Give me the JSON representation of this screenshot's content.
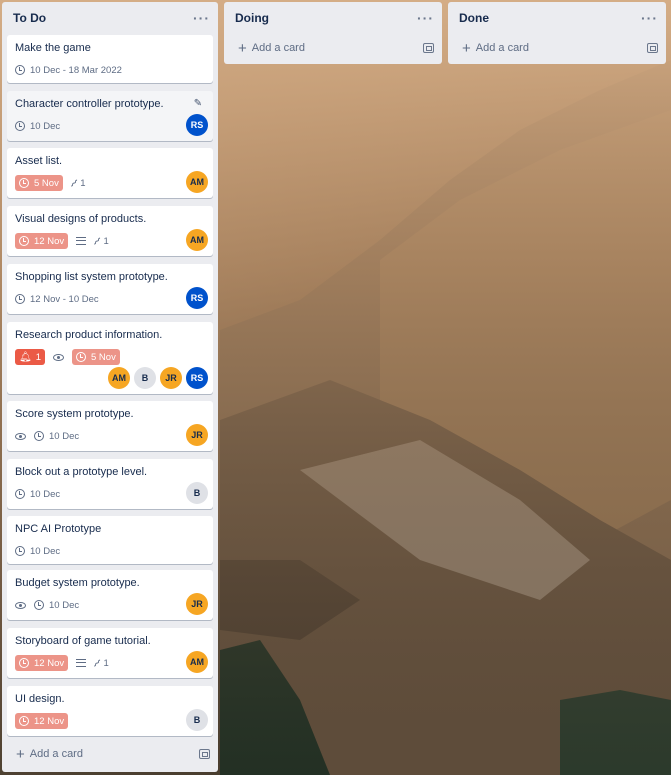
{
  "lists": {
    "todo": {
      "title": "To Do",
      "menu": "···",
      "add_card": "Add a card",
      "cards": [
        {
          "title": "Make the game",
          "due": "10 Dec - 18 Mar 2022"
        },
        {
          "title": "Character controller prototype.",
          "due": "10 Dec",
          "members": [
            "RS"
          ]
        },
        {
          "title": "Asset list.",
          "due": "5 Nov",
          "attachments": "1",
          "members": [
            "AM"
          ]
        },
        {
          "title": "Visual designs of products.",
          "due": "12 Nov",
          "attachments": "1",
          "members": [
            "AM"
          ]
        },
        {
          "title": "Shopping list system prototype.",
          "due": "12 Nov - 10 Dec",
          "members": [
            "RS"
          ]
        },
        {
          "title": "Research product information.",
          "notifications": "1",
          "due": "5 Nov",
          "members": [
            "AM",
            "B",
            "JR",
            "RS"
          ]
        },
        {
          "title": "Score system prototype.",
          "due": "10 Dec",
          "members": [
            "JR"
          ]
        },
        {
          "title": "Block out a prototype level.",
          "due": "10 Dec",
          "members": [
            "B"
          ]
        },
        {
          "title": "NPC AI Prototype",
          "due": "10 Dec"
        },
        {
          "title": "Budget system prototype.",
          "due": "10 Dec",
          "members": [
            "JR"
          ]
        },
        {
          "title": "Storyboard of game tutorial.",
          "due": "12 Nov",
          "attachments": "1",
          "members": [
            "AM"
          ]
        },
        {
          "title": "UI design.",
          "due": "12 Nov",
          "members": [
            "B"
          ]
        }
      ]
    },
    "doing": {
      "title": "Doing",
      "menu": "···",
      "add_card": "Add a card"
    },
    "done": {
      "title": "Done",
      "menu": "···",
      "add_card": "Add a card"
    }
  },
  "icons": {
    "clock": "clock-icon",
    "watch": "eye-icon",
    "description": "description-icon",
    "attachment": "paperclip-icon",
    "notification": "bell-icon",
    "edit": "pencil-icon",
    "template": "card-template-icon"
  },
  "colors": {
    "list_bg": "#ebecf0",
    "due_overdue": "#ec9488",
    "notification": "#eb5a46",
    "avatar_rs": "#0052cc",
    "avatar_am": "#f6a623",
    "avatar_b": "#dfe1e6"
  }
}
